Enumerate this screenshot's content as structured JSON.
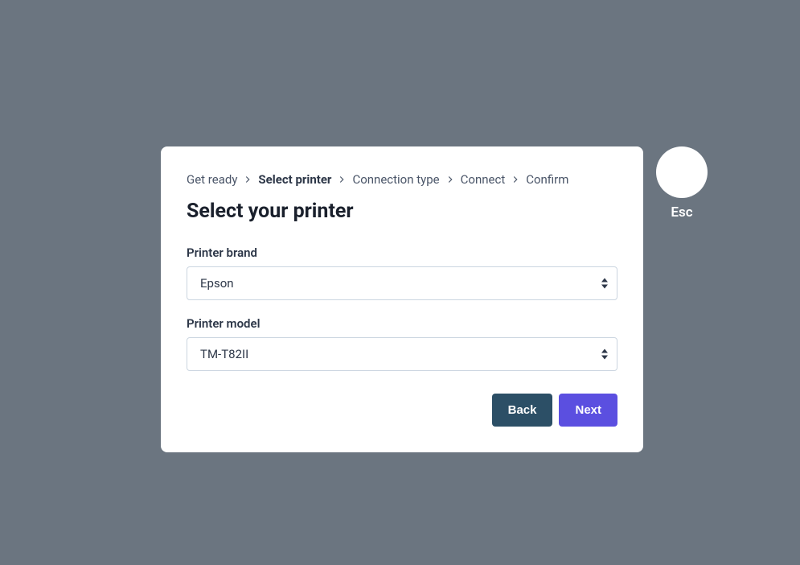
{
  "breadcrumb": {
    "items": [
      {
        "label": "Get ready",
        "active": false
      },
      {
        "label": "Select printer",
        "active": true
      },
      {
        "label": "Connection type",
        "active": false
      },
      {
        "label": "Connect",
        "active": false
      },
      {
        "label": "Confirm",
        "active": false
      }
    ]
  },
  "modal": {
    "title": "Select your printer"
  },
  "form": {
    "brand": {
      "label": "Printer brand",
      "value": "Epson"
    },
    "model": {
      "label": "Printer model",
      "value": "TM-T82II"
    }
  },
  "buttons": {
    "back": "Back",
    "next": "Next"
  },
  "esc": {
    "label": "Esc"
  }
}
